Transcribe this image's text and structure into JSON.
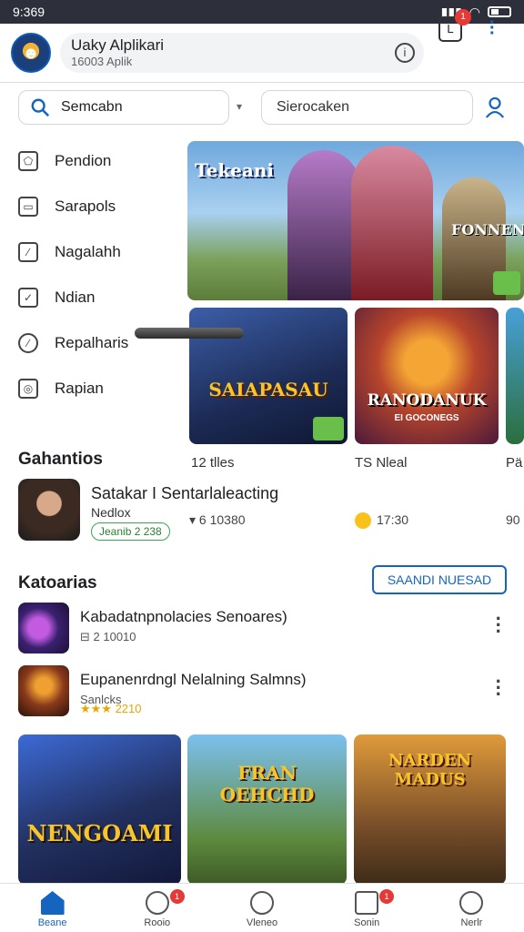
{
  "status": {
    "time": "9:369"
  },
  "header": {
    "title": "Uaky Alplikari",
    "subtitle": "16003 Aplik",
    "notif_icon_letter": "L",
    "notif_count": "1"
  },
  "search": {
    "primary_text": "Semcabn",
    "secondary_text": "Sierocaken"
  },
  "sidebar": {
    "items": [
      {
        "label": "Pendion",
        "icon": "pentagon-icon"
      },
      {
        "label": "Sarapols",
        "icon": "window-icon"
      },
      {
        "label": "Nagalahh",
        "icon": "edit-icon"
      },
      {
        "label": "Ndian",
        "icon": "check-icon"
      },
      {
        "label": "Repalharis",
        "icon": "shield-icon"
      },
      {
        "label": "Rapian",
        "icon": "bag-icon"
      }
    ]
  },
  "hero": {
    "title": "Tekeani",
    "subtitle": "FONNENIN"
  },
  "cards": {
    "card1": {
      "label": "SAIAPASAU",
      "caption": "12 tlles"
    },
    "card2": {
      "label": "RANODANUK",
      "sub": "EI GOCONEGS",
      "caption": "TS Nleal"
    },
    "card3": {
      "caption": "Pä"
    }
  },
  "featured": {
    "section_title": "Gahantios",
    "title": "Satakar I Sentarlaleacting",
    "sub": "Nedlox",
    "pill": "Jeanib 2 238",
    "meta1": "6 10380",
    "meta2": "17:30",
    "meta3": "90"
  },
  "categories": {
    "section_title": "Katoarias",
    "button_label": "SAANDI NUESAD",
    "rows": [
      {
        "title": "Kabadatnpnolacies Senoares)",
        "sub": "2 10010"
      },
      {
        "title": "Eupanenrdngl Nelalning Salmns)",
        "sub": "Sanlcks",
        "rating": "★★★ 2210"
      }
    ]
  },
  "banners": [
    {
      "label": "NENGOAMI"
    },
    {
      "label": "FRAN OEHCHD"
    },
    {
      "label": "NARDEN MADUS"
    }
  ],
  "bottom_nav": [
    {
      "label": "Beane"
    },
    {
      "label": "Rooio",
      "badge": "1"
    },
    {
      "label": "Vleneo"
    },
    {
      "label": "Sonin",
      "badge": "1"
    },
    {
      "label": "Nerlr"
    }
  ]
}
